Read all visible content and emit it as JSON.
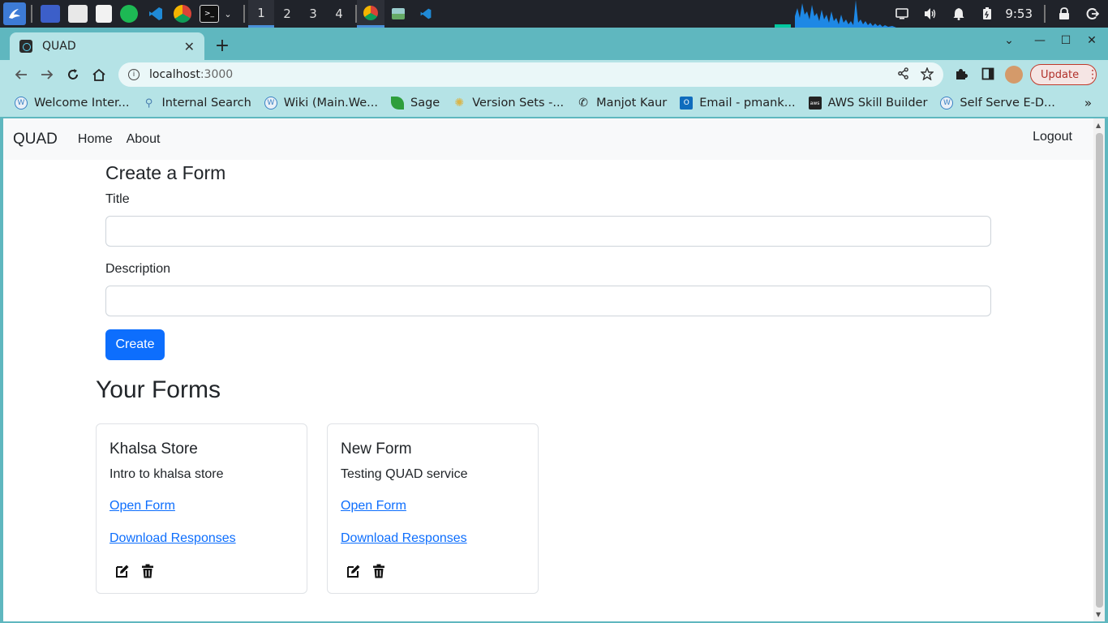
{
  "taskbar": {
    "workspaces": [
      "1",
      "2",
      "3",
      "4"
    ],
    "active_workspace": "1",
    "clock": "9:53"
  },
  "browser": {
    "tab_title": "QUAD",
    "url_host": "localhost",
    "url_port": ":3000",
    "update_label": "Update",
    "bookmarks": [
      {
        "label": "Welcome Inter...",
        "color": "#3b82c4",
        "icon": "wiki-icon"
      },
      {
        "label": "Internal Search",
        "color": "#4a7fb0",
        "icon": "search-icon"
      },
      {
        "label": "Wiki (Main.We...",
        "color": "#3b82c4",
        "icon": "wiki-icon"
      },
      {
        "label": "Sage",
        "color": "#2e9e3c",
        "icon": "leaf-icon"
      },
      {
        "label": "Version Sets -...",
        "color": "#d9b54a",
        "icon": "gear-icon"
      },
      {
        "label": "Manjot Kaur",
        "color": "#222222",
        "icon": "phone-icon"
      },
      {
        "label": "Email - pmank...",
        "color": "#0f6cbd",
        "icon": "outlook-icon"
      },
      {
        "label": "AWS Skill Builder",
        "color": "#222222",
        "icon": "aws-icon"
      },
      {
        "label": "Self Serve E-D...",
        "color": "#3b82c4",
        "icon": "wiki-icon"
      }
    ]
  },
  "app": {
    "brand": "QUAD",
    "nav": {
      "home": "Home",
      "about": "About",
      "logout": "Logout"
    },
    "create_form": {
      "heading": "Create a Form",
      "title_label": "Title",
      "description_label": "Description",
      "submit_label": "Create"
    },
    "forms_heading": "Your Forms",
    "forms": [
      {
        "title": "Khalsa Store",
        "description": "Intro to khalsa store",
        "open_label": "Open Form",
        "download_label": "Download Responses"
      },
      {
        "title": "New Form",
        "description": "Testing QUAD service",
        "open_label": "Open Form",
        "download_label": "Download Responses"
      }
    ]
  },
  "colors": {
    "primary": "#0d6efd",
    "browser_chrome": "#b5e3e6",
    "update_red": "#c0392b"
  }
}
